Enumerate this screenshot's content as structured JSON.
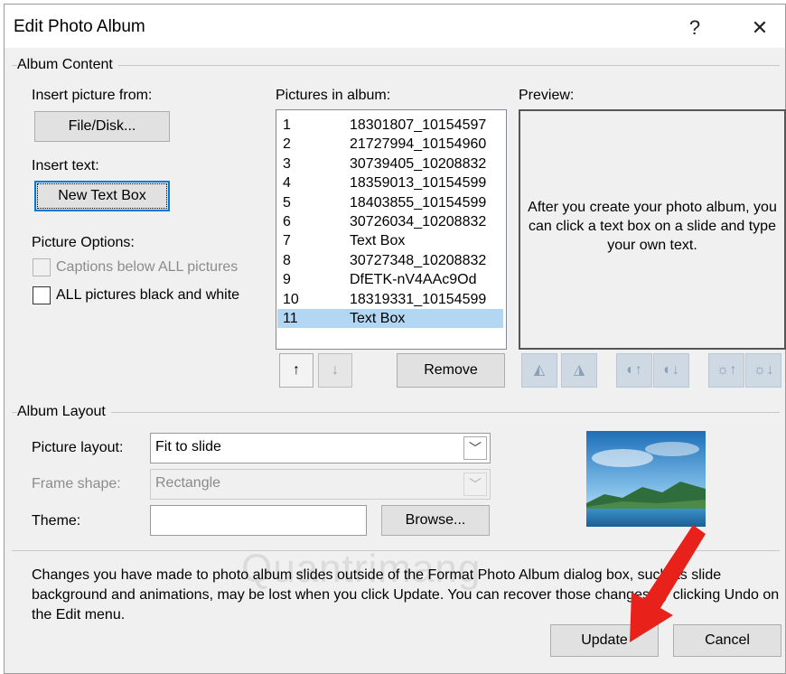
{
  "window": {
    "title": "Edit Photo Album",
    "help": "?",
    "close": "✕"
  },
  "album_content": {
    "group_label": "Album Content",
    "insert_picture_label": "Insert picture from:",
    "file_disk_button": "File/Disk...",
    "insert_text_label": "Insert text:",
    "new_text_box_button": "New Text Box",
    "picture_options_label": "Picture Options:",
    "captions_option": "Captions below ALL pictures",
    "bw_option": "ALL pictures black and white",
    "pictures_label": "Pictures in album:",
    "pictures": [
      {
        "num": "1",
        "name": "18301807_10154597"
      },
      {
        "num": "2",
        "name": "21727994_10154960"
      },
      {
        "num": "3",
        "name": "30739405_10208832"
      },
      {
        "num": "4",
        "name": "18359013_10154599"
      },
      {
        "num": "5",
        "name": "18403855_10154599"
      },
      {
        "num": "6",
        "name": "30726034_10208832"
      },
      {
        "num": "7",
        "name": "Text Box"
      },
      {
        "num": "8",
        "name": "30727348_10208832"
      },
      {
        "num": "9",
        "name": "DfETK-nV4AAc9Od"
      },
      {
        "num": "10",
        "name": "18319331_10154599"
      },
      {
        "num": "11",
        "name": "Text Box"
      }
    ],
    "selected_index": 10,
    "move_up": "↑",
    "move_down": "↓",
    "remove_button": "Remove",
    "preview_label": "Preview:",
    "preview_text": "After you create your photo album, you can click a text box on a slide and type your own text."
  },
  "album_layout": {
    "group_label": "Album Layout",
    "picture_layout_label": "Picture layout:",
    "picture_layout_value": "Fit to slide",
    "frame_shape_label": "Frame shape:",
    "frame_shape_value": "Rectangle",
    "theme_label": "Theme:",
    "theme_value": "",
    "browse_button": "Browse..."
  },
  "footer": {
    "note": "Changes you have made to photo album slides outside of the Format Photo Album dialog box, such as slide background and animations, may be lost when you click Update. You can recover those changes by clicking Undo on the Edit menu.",
    "update_button": "Update",
    "cancel_button": "Cancel"
  },
  "colors": {
    "accent": "#0078d7",
    "selection": "#b3d7f3",
    "arrow": "#e8221b"
  }
}
